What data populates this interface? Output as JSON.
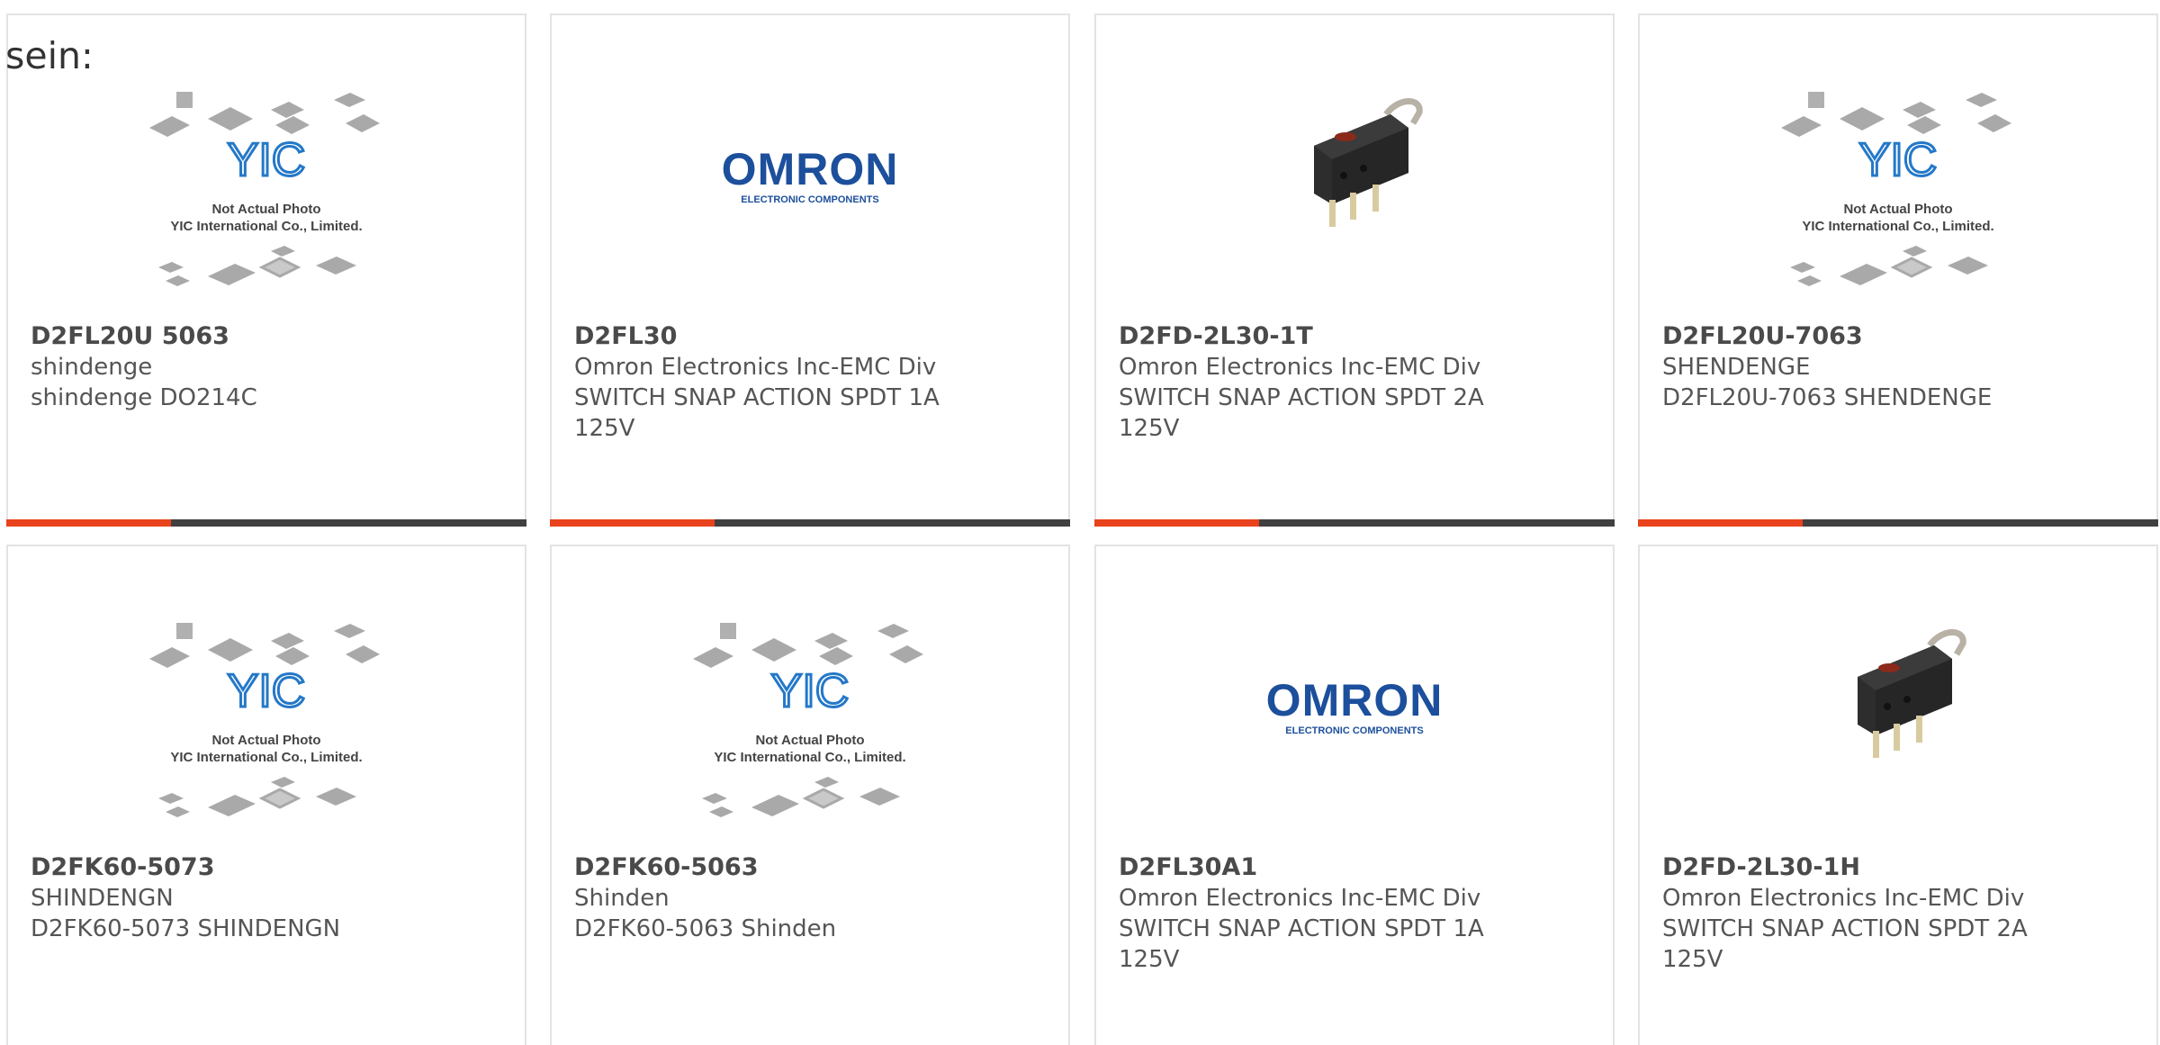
{
  "lead": {
    "text": "sein:"
  },
  "image_labels": {
    "yic_line1": "Not Actual Photo",
    "yic_line2": "YIC International Co., Limited.",
    "yic_logo": "YIC",
    "omron_logo": "OMRON",
    "omron_sub": "ELECTRONIC COMPONENTS"
  },
  "colors": {
    "accent_red": "#e8431c",
    "accent_dark": "#404040",
    "omron_blue": "#1c4f9c",
    "yic_blue": "#2478c8"
  },
  "products": [
    {
      "part": "D2FL20U 5063",
      "line1": "shindenge",
      "line2": "shindenge DO214C",
      "image": "yic-placeholder"
    },
    {
      "part": "D2FL30",
      "line1": "Omron Electronics Inc-EMC Div",
      "line2": "SWITCH SNAP ACTION SPDT 1A 125V",
      "image": "omron-logo"
    },
    {
      "part": "D2FD-2L30-1T",
      "line1": "Omron Electronics Inc-EMC Div",
      "line2": "SWITCH SNAP ACTION SPDT 2A 125V",
      "image": "switch-photo"
    },
    {
      "part": "D2FL20U-7063",
      "line1": "SHENDENGE",
      "line2": "D2FL20U-7063 SHENDENGE",
      "image": "yic-placeholder"
    },
    {
      "part": "D2FK60-5073",
      "line1": "SHINDENGN",
      "line2": "D2FK60-5073 SHINDENGN",
      "image": "yic-placeholder"
    },
    {
      "part": "D2FK60-5063",
      "line1": "Shinden",
      "line2": "D2FK60-5063 Shinden",
      "image": "yic-placeholder"
    },
    {
      "part": "D2FL30A1",
      "line1": "Omron Electronics Inc-EMC Div",
      "line2": "SWITCH SNAP ACTION SPDT 1A 125V",
      "image": "omron-logo"
    },
    {
      "part": "D2FD-2L30-1H",
      "line1": "Omron Electronics Inc-EMC Div",
      "line2": "SWITCH SNAP ACTION SPDT 2A 125V",
      "image": "switch-photo"
    }
  ]
}
